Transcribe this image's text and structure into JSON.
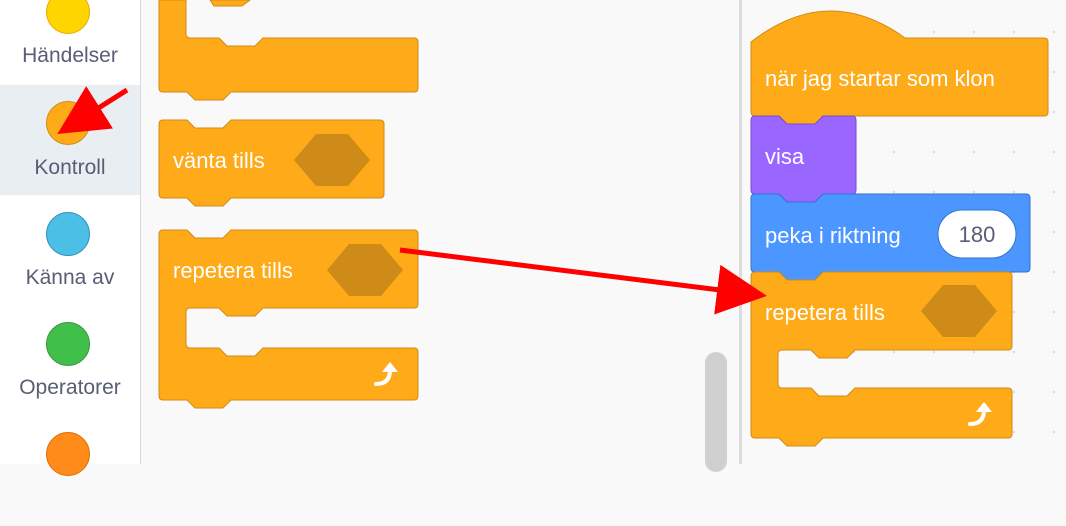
{
  "categories": [
    {
      "label": "Händelser",
      "color": "#ffd500",
      "border": "#e6ac00"
    },
    {
      "label": "Kontroll",
      "color": "#ffab19",
      "border": "#cf8b17",
      "selected": true
    },
    {
      "label": "Känna av",
      "color": "#4cbfe6",
      "border": "#2e8eb8"
    },
    {
      "label": "Operatorer",
      "color": "#40bf4a",
      "border": "#389438"
    },
    {
      "label": "",
      "color": "#ff8c1a",
      "border": "#db6e00"
    }
  ],
  "palette": {
    "wait_until_label": "vänta tills",
    "repeat_until_label": "repetera tills"
  },
  "script": {
    "hat_label": "när jag startar som klon",
    "show_label": "visa",
    "point_label": "peka i riktning",
    "point_value": "180",
    "repeat_until_label": "repetera tills"
  },
  "colors": {
    "control": "#ffab19",
    "control_border": "#cf8b17",
    "hexagon": "#cf8b17",
    "looks": "#9966ff",
    "looks_border": "#774dcb",
    "motion": "#4c97ff",
    "motion_border": "#3373cc",
    "arrow": "#ff0000"
  },
  "icons": [
    "repeat-arrow-icon"
  ]
}
